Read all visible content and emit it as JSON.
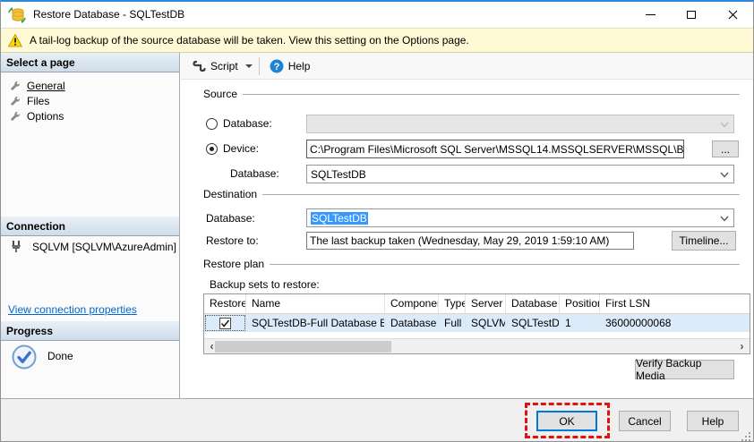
{
  "window": {
    "title": "Restore Database - SQLTestDB"
  },
  "warning": {
    "text": "A tail-log backup of the source database will be taken. View this setting on the Options page."
  },
  "sidebar": {
    "select_page_header": "Select a page",
    "pages": [
      {
        "label": "General"
      },
      {
        "label": "Files"
      },
      {
        "label": "Options"
      }
    ],
    "connection_header": "Connection",
    "connection_value": "SQLVM [SQLVM\\AzureAdmin]",
    "connection_link": "View connection properties",
    "progress_header": "Progress",
    "progress_status": "Done"
  },
  "toolbar": {
    "script_label": "Script",
    "help_label": "Help"
  },
  "source": {
    "group_label": "Source",
    "database_radio_label": "Database:",
    "device_radio_label": "Device:",
    "device_path": "C:\\Program Files\\Microsoft SQL Server\\MSSQL14.MSSQLSERVER\\MSSQL\\Bac",
    "browse_label": "...",
    "database_label": "Database:",
    "database_value": "SQLTestDB"
  },
  "destination": {
    "group_label": "Destination",
    "database_label": "Database:",
    "database_value": "SQLTestDB",
    "restore_to_label": "Restore to:",
    "restore_to_value": "The last backup taken (Wednesday, May 29, 2019 1:59:10 AM)",
    "timeline_label": "Timeline..."
  },
  "restore_plan": {
    "group_label": "Restore plan",
    "backup_sets_label": "Backup sets to restore:",
    "columns": [
      "Restore",
      "Name",
      "Component",
      "Type",
      "Server",
      "Database",
      "Position",
      "First LSN"
    ],
    "rows": [
      {
        "restore_checked": true,
        "name": "SQLTestDB-Full Database Backup",
        "component": "Database",
        "type": "Full",
        "server": "SQLVM",
        "database": "SQLTestDB",
        "position": "1",
        "first_lsn": "36000000068"
      }
    ],
    "verify_label": "Verify Backup Media"
  },
  "footer": {
    "ok_label": "OK",
    "cancel_label": "Cancel",
    "help_label": "Help"
  },
  "icons": {
    "scroll_left": "‹",
    "scroll_right": "›"
  },
  "colors": {
    "accent": "#0078d7",
    "selection": "#3399ff",
    "warning_bg": "#fff9d5",
    "annotation_red": "#e01212",
    "link": "#0066cc"
  }
}
